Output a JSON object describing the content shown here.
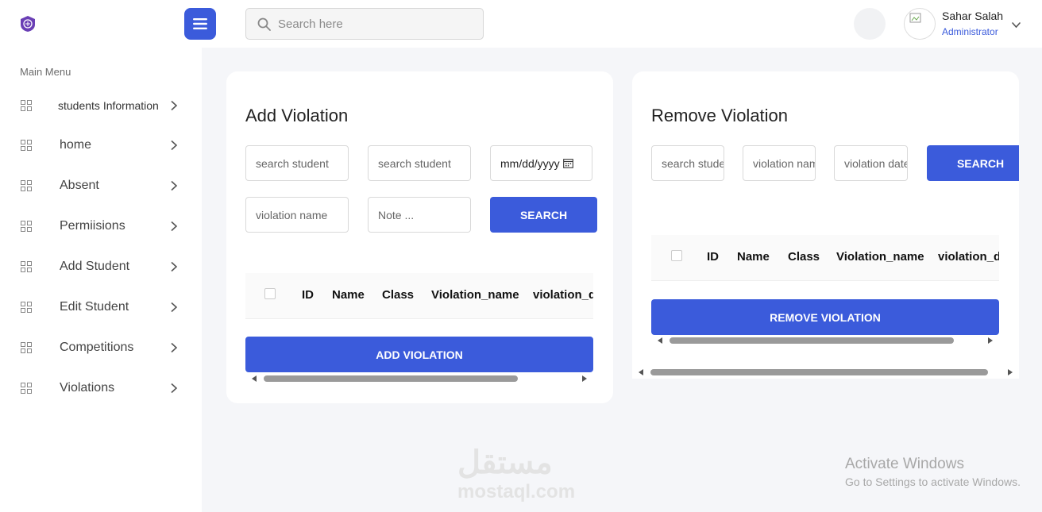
{
  "header": {
    "search_placeholder": "Search here",
    "user": {
      "name": "Sahar Salah",
      "role": "Administrator"
    }
  },
  "sidebar": {
    "title": "Main Menu",
    "items": [
      {
        "label": "students Information"
      },
      {
        "label": "home"
      },
      {
        "label": "Absent"
      },
      {
        "label": "Permiisions"
      },
      {
        "label": "Add Student"
      },
      {
        "label": "Edit Student"
      },
      {
        "label": "Competitions"
      },
      {
        "label": "Violations"
      }
    ]
  },
  "add_violation": {
    "title": "Add Violation",
    "search_student_1": "search student",
    "search_student_2": "search student",
    "date_value": "mm/dd/yyyy",
    "violation_name": "violation name",
    "note": "Note ...",
    "search_label": "SEARCH",
    "columns": [
      "ID",
      "Name",
      "Class",
      "Violation_name",
      "violation_date"
    ],
    "submit_label": "ADD VIOLATION"
  },
  "remove_violation": {
    "title": "Remove Violation",
    "search_student": "search student",
    "violation_name": "violation name",
    "violation_date": "violation date",
    "search_label": "SEARCH",
    "columns": [
      "ID",
      "Name",
      "Class",
      "Violation_name",
      "violation_date"
    ],
    "submit_label": "REMOVE VIOLATION"
  },
  "watermark": {
    "logo_text": "مستقل",
    "site": "mostaql.com"
  },
  "activation": {
    "title": "Activate Windows",
    "subtitle": "Go to Settings to activate Windows."
  },
  "colors": {
    "primary": "#3b5bdb",
    "background": "#f5f6f9"
  }
}
